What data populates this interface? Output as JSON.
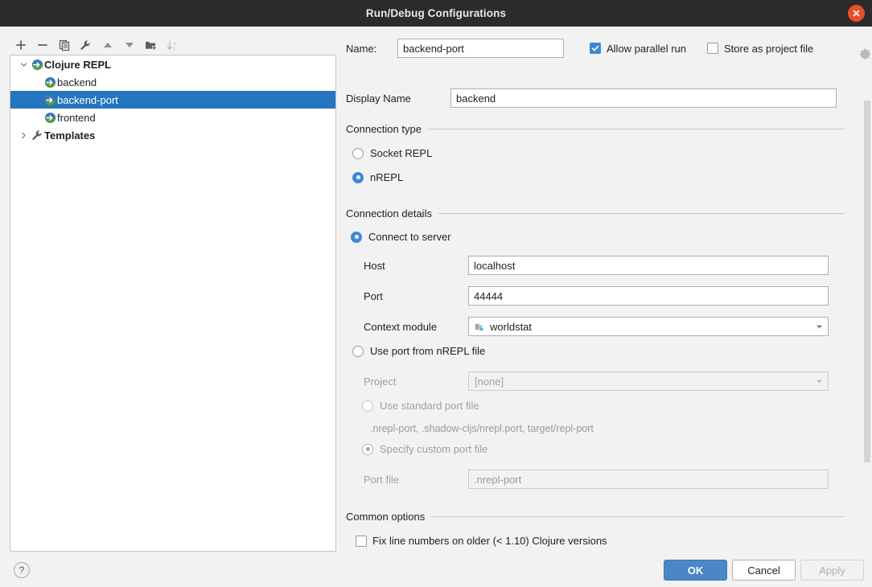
{
  "window": {
    "title": "Run/Debug Configurations",
    "close_icon": "close-icon"
  },
  "toolbar": {
    "buttons": [
      {
        "name": "add-configuration-button",
        "icon": "plus-icon",
        "title": "Add New Configuration"
      },
      {
        "name": "remove-configuration-button",
        "icon": "minus-icon",
        "title": "Remove Configuration"
      },
      {
        "name": "copy-configuration-button",
        "icon": "copy-icon",
        "title": "Copy Configuration"
      },
      {
        "name": "edit-templates-button",
        "icon": "wrench-icon",
        "title": "Edit Templates"
      },
      {
        "name": "move-up-button",
        "icon": "arrow-up-icon",
        "title": "Move Up"
      },
      {
        "name": "move-down-button",
        "icon": "arrow-down-icon",
        "title": "Move Down"
      },
      {
        "name": "move-into-folder-button",
        "icon": "folder-add-icon",
        "title": "Move into new folder"
      },
      {
        "name": "sort-configurations-button",
        "icon": "sort-az-icon",
        "title": "Sort Configurations"
      }
    ]
  },
  "tree": {
    "nodes": [
      {
        "label": "Clojure REPL",
        "level": 0,
        "icon": "clojure-repl-icon",
        "arrow": "chevron-down",
        "bold": true,
        "selected": false
      },
      {
        "label": "backend",
        "level": 1,
        "icon": "clojure-repl-icon",
        "arrow": "",
        "bold": false,
        "selected": false
      },
      {
        "label": "backend-port",
        "level": 1,
        "icon": "clojure-repl-icon",
        "arrow": "",
        "bold": false,
        "selected": true
      },
      {
        "label": "frontend",
        "level": 1,
        "icon": "clojure-repl-icon",
        "arrow": "",
        "bold": false,
        "selected": false
      },
      {
        "label": "Templates",
        "level": 0,
        "icon": "wrench-icon",
        "arrow": "chevron-right",
        "bold": true,
        "selected": false
      }
    ]
  },
  "form": {
    "name_label": "Name:",
    "name_value": "backend-port",
    "allow_parallel_run": {
      "label": "Allow parallel run",
      "checked": true
    },
    "store_as_project_file": {
      "label": "Store as project file",
      "checked": false
    },
    "gear_icon": "gear-icon",
    "display_name_label": "Display Name",
    "display_name_value": "backend",
    "connection_type": {
      "title": "Connection type",
      "options": [
        {
          "label": "Socket REPL",
          "selected": false
        },
        {
          "label": "nREPL",
          "selected": true
        }
      ]
    },
    "connection_details": {
      "title": "Connection details",
      "connect_to_server": {
        "label": "Connect to server",
        "selected": true
      },
      "host_label": "Host",
      "host_value": "localhost",
      "port_label": "Port",
      "port_value": "44444",
      "context_module_label": "Context module",
      "context_module_value": "worldstat",
      "context_module_icon": "module-icon",
      "use_port_from_nrepl_file": {
        "label": "Use port from nREPL file",
        "selected": false
      },
      "project_label": "Project",
      "project_value": "[none]",
      "use_standard_port_file": {
        "label": "Use standard port file",
        "selected": false
      },
      "standard_port_file_hint": ".nrepl-port, .shadow-cljs/nrepl.port, target/repl-port",
      "specify_custom_port_file": {
        "label": "Specify custom port file",
        "selected": true
      },
      "port_file_label": "Port file",
      "port_file_value": ".nrepl-port"
    },
    "common_options": {
      "title": "Common options",
      "fix_line_numbers": {
        "label": "Fix line numbers on older (< 1.10) Clojure versions",
        "checked": false
      }
    }
  },
  "footer": {
    "help_label": "?",
    "ok_label": "OK",
    "cancel_label": "Cancel",
    "apply_label": "Apply"
  },
  "colors": {
    "titlebar": "#2b2b2b",
    "close": "#e8502a",
    "selection": "#2675bf",
    "accent": "#3d87d8",
    "ok_button": "#4a86c8"
  }
}
